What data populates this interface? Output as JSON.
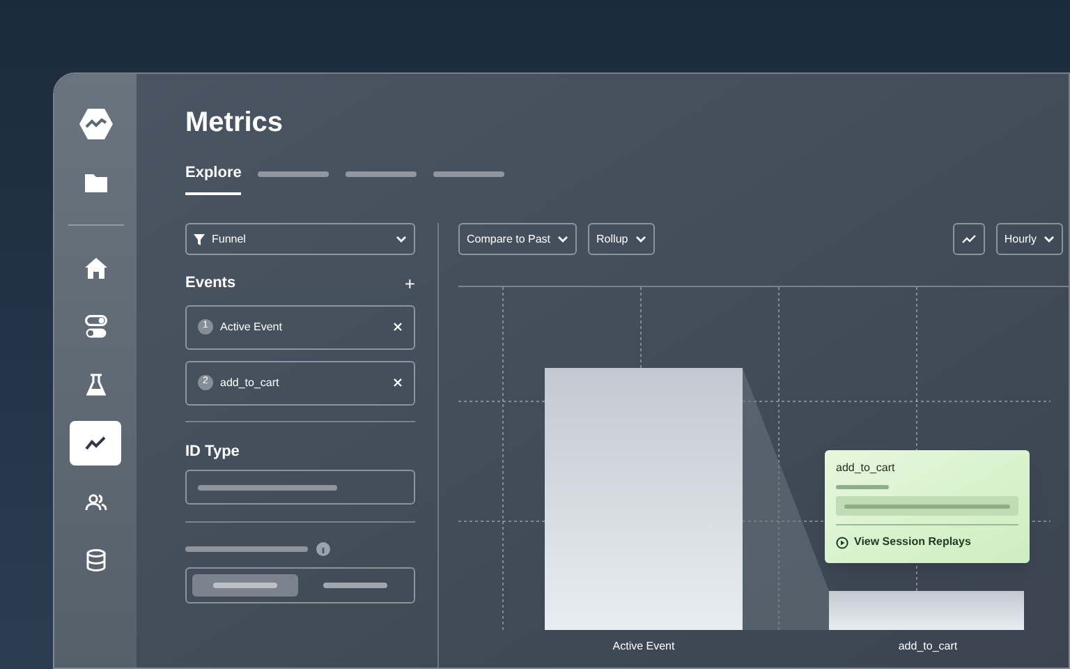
{
  "window": {
    "title": "Metrics"
  },
  "sidebar": {
    "items": [
      {
        "kind": "logo",
        "selected": false
      },
      {
        "kind": "folder",
        "selected": false
      },
      {
        "kind": "home",
        "selected": false
      },
      {
        "kind": "toggles",
        "selected": false
      },
      {
        "kind": "flask",
        "selected": false
      },
      {
        "kind": "chart",
        "selected": true
      },
      {
        "kind": "users",
        "selected": false
      },
      {
        "kind": "database",
        "selected": false
      }
    ]
  },
  "tabs": [
    {
      "kind": "text",
      "label": "Explore",
      "selected": true
    },
    {
      "kind": "skeleton",
      "selected": false
    },
    {
      "kind": "skeleton",
      "selected": false
    },
    {
      "kind": "skeleton",
      "selected": false
    }
  ],
  "query": {
    "type_select": "Funnel",
    "events_heading": "Events",
    "add_symbol": "+",
    "events": [
      {
        "number": "1",
        "name": "Active Event"
      },
      {
        "number": "2",
        "name": "add_to_cart"
      }
    ],
    "id_type_heading": "ID Type",
    "segments": [
      {
        "selected": true
      },
      {
        "selected": false
      }
    ]
  },
  "toolbar": {
    "left": [
      "Compare to Past",
      "Rollup"
    ],
    "interval": "Hourly"
  },
  "chart": {
    "labels": [
      "Active Event",
      "add_to_cart"
    ],
    "tooltip": {
      "title": "add_to_cart",
      "action": "View Session Replays"
    }
  }
}
